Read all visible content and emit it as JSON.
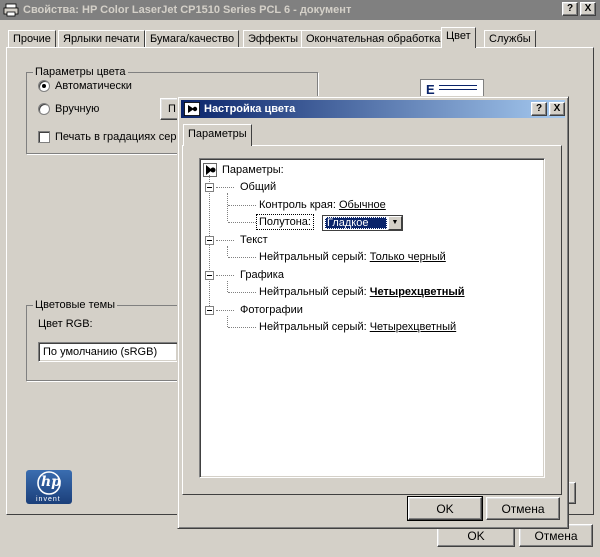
{
  "outer": {
    "title": "Свойства: HP Color LaserJet CP1510 Series PCL 6 - документ",
    "help_glyph": "?",
    "close_glyph": "X",
    "tabs": [
      {
        "label": "Прочие"
      },
      {
        "label": "Ярлыки печати"
      },
      {
        "label": "Бумага/качество"
      },
      {
        "label": "Эффекты"
      },
      {
        "label": "Окончательная обработка"
      },
      {
        "label": "Цвет",
        "active": true
      },
      {
        "label": "Службы"
      }
    ],
    "color_group": {
      "label": "Параметры цвета",
      "auto_label": "Автоматически",
      "manual_label": "Вручную",
      "manual_button_label": "П",
      "grayscale_label": "Печать в градациях серо"
    },
    "themes_group": {
      "label": "Цветовые темы",
      "rgb_label": "Цвет RGB:",
      "rgb_value": "По умолчанию (sRGB)"
    },
    "preview_letter": "E",
    "hp_logo_text": "hp",
    "hp_invent_text": "invent",
    "ok_label": "OK",
    "cancel_label": "Отмена"
  },
  "dialog": {
    "title": "Настройка цвета",
    "help_glyph": "?",
    "close_glyph": "X",
    "tab_label": "Параметры",
    "tree": {
      "root": "Параметры:",
      "general": "Общий",
      "edge_control_label": "Контроль края:",
      "edge_control_value": "Обычное",
      "halftone_label": "Полутона:",
      "halftone_value": "Гладкое",
      "text": "Текст",
      "text_gray_label": "Нейтральный серый:",
      "text_gray_value": "Только черный",
      "graphics": "Графика",
      "graphics_gray_label": "Нейтральный серый:",
      "graphics_gray_value": "Четырехцветный",
      "photos": "Фотографии",
      "photos_gray_label": "Нейтральный серый:",
      "photos_gray_value": "Четырехцветный"
    },
    "ok_label": "OK",
    "cancel_label": "Отмена"
  },
  "colors": {
    "active_title": "#0a246a",
    "inactive_title": "#808080",
    "face": "#d4d0c8"
  }
}
